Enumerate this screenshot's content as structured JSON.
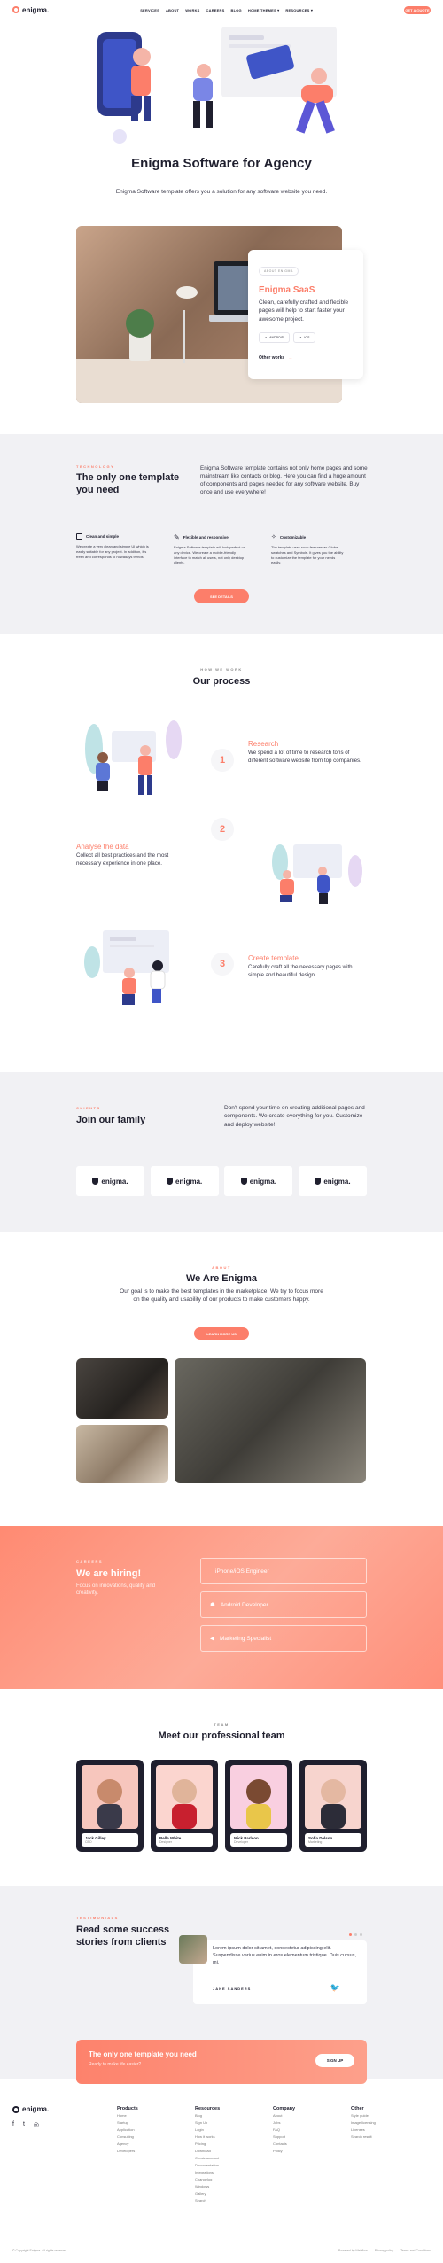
{
  "brand": {
    "name": "enigma.",
    "accent": "#fc7e6a",
    "dark": "#1f1f2e",
    "bg_grey": "#f1f1f4"
  },
  "nav": {
    "items": [
      "SERVICES",
      "ABOUT",
      "WORKS",
      "CAREERS",
      "BLOG",
      "HOME THEMES",
      "RESOURCES"
    ],
    "cta": "GET A QUOTE"
  },
  "hero": {
    "title": "Enigma Software for Agency",
    "subtitle": "Enigma Software template offers you a solution for any software website you need.",
    "card_tag": "ABOUT ENIGMA",
    "card_title": "Enigma SaaS",
    "card_text": "Clean, carefully crafted and flexible pages will help to start faster your awesome project.",
    "card_badges": [
      "ANDROID",
      "IOS"
    ],
    "card_link": "Other works"
  },
  "features": {
    "eyebrow": "TECHNOLOGY",
    "title": "The only one template you need",
    "text": "Enigma Software template contains not only home pages and some mainstream like contacts or blog. Here you can find a huge amount of components and pages needed for any software website. Buy once and use everywhere!",
    "items": [
      {
        "icon": "square-icon",
        "title": "Clean and simple",
        "text": "We create a very clean and simple UI which is easily suitable for any project. In addition, it's fresh and corresponds to nowadays trends."
      },
      {
        "icon": "pen-icon",
        "title": "Flexible and responsive",
        "text": "Enigma Software template will look perfect on any device. We create a mobile-friendly interface to match all users, not only desktop clients."
      },
      {
        "icon": "wand-icon",
        "title": "Customizable",
        "text": "The template uses such features as Global swatches and Symbols. It gives you the ability to customize the template for your needs easily."
      }
    ],
    "cta": "SEE DETAILS"
  },
  "process": {
    "eyebrow": "HOW WE WORK",
    "title": "Our process",
    "steps": [
      {
        "num": "1",
        "title": "Research",
        "text": "We spend a lot of time to research tons of different software website from top companies."
      },
      {
        "num": "2",
        "title": "Analyse the data",
        "text": "Collect all best practices and the most necessary experience in one place."
      },
      {
        "num": "3",
        "title": "Create template",
        "text": "Carefully craft all the necessary pages with simple and beautiful design."
      }
    ]
  },
  "clients": {
    "eyebrow": "CLIENTS",
    "title": "Join our family",
    "text": "Don't spend your time on creating additional pages and components. We create everything for you. Customize and deploy website!",
    "logos": [
      "enigma.",
      "enigma.",
      "enigma.",
      "enigma."
    ]
  },
  "about": {
    "eyebrow": "ABOUT",
    "title": "We Are Enigma",
    "text": "Our goal is to make the best templates in the marketplace. We try to focus more on the quality and usability of our products to make customers happy.",
    "cta": "LEARN MORE US"
  },
  "hiring": {
    "eyebrow": "CAREERS",
    "title": "We are hiring!",
    "text": "Focus on innovations, quality and creativity.",
    "jobs": [
      "iPhone/iOS Engineer",
      "Android Developer",
      "Marketing Specialist"
    ]
  },
  "team": {
    "eyebrow": "TEAM",
    "title": "Meet our professional team",
    "members": [
      {
        "name": "Jack Gilley",
        "role": "CEO",
        "bg": "#f7c6bd"
      },
      {
        "name": "Bella White",
        "role": "Designer",
        "bg": "#fbd5cf"
      },
      {
        "name": "Mick Parlson",
        "role": "Developer",
        "bg": "#f9cfe0"
      },
      {
        "name": "Sofia Delson",
        "role": "Marketing",
        "bg": "#f7d4ce"
      }
    ]
  },
  "testimonials": {
    "eyebrow": "TESTIMONIALS",
    "title": "Read some success stories from clients",
    "quote": "Lorem ipsum dolor sit amet, consectetur adipiscing elit. Suspendisse varius enim in eros elementum tristique. Duis cursus, mi.",
    "author": "JANE SANDERS"
  },
  "cta_banner": {
    "title": "The only one template you need",
    "text": "Ready to make life easier?",
    "button": "SIGN UP"
  },
  "footer": {
    "columns": [
      {
        "title": "Products",
        "links": [
          "Home",
          "Startup",
          "Application",
          "Consulting",
          "Agency",
          "Developers"
        ]
      },
      {
        "title": "Resources",
        "links": [
          "Blog",
          "Sign Up",
          "Login",
          "How it works",
          "Pricing",
          "Download",
          "Create account",
          "Documentation",
          "Integrations",
          "Changelog",
          "Windows",
          "Gallery",
          "Search"
        ]
      },
      {
        "title": "Company",
        "links": [
          "About",
          "Jobs",
          "FAQ",
          "Support",
          "Contacts",
          "Policy"
        ]
      },
      {
        "title": "Other",
        "links": [
          "Style guide",
          "Image licensing",
          "Licenses",
          "Search result"
        ]
      }
    ],
    "copyright": "© Copyright Enigma. All rights reserved.",
    "legal": [
      "Powered by Webflow",
      "Privacy policy",
      "Terms and Conditions"
    ]
  }
}
